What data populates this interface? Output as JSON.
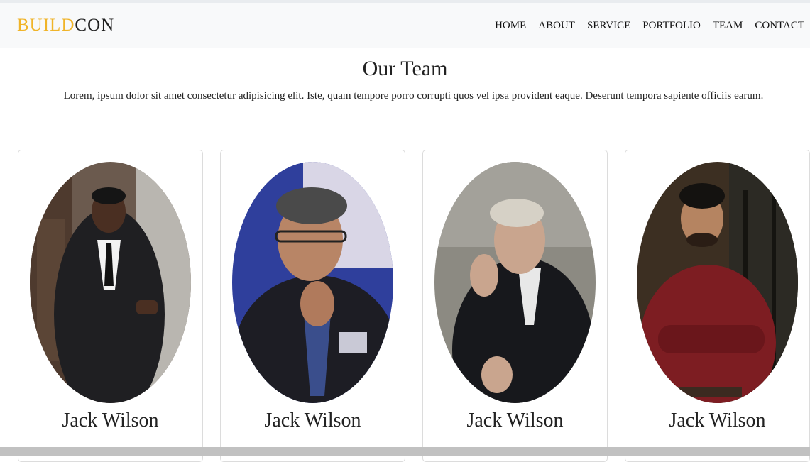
{
  "brand": {
    "part1": "BUILD",
    "part2": "CON"
  },
  "nav": [
    "HOME",
    "ABOUT",
    "SERVICE",
    "PORTFOLIO",
    "TEAM",
    "CONTACT"
  ],
  "team": {
    "title": "Our Team",
    "text": "Lorem, ipsum dolor sit amet consectetur adipisicing elit. Iste, quam tempore porro corrupti quos vel ipsa provident eaque. Deserunt tempora sapiente officiis earum.",
    "members": [
      {
        "name": "Jack Wilson"
      },
      {
        "name": "Jack Wilson"
      },
      {
        "name": "Jack Wilson"
      },
      {
        "name": "Jack Wilson"
      }
    ]
  },
  "colors": {
    "brand_accent": "#f0b429",
    "navbar_bg": "#f8f9fa"
  }
}
